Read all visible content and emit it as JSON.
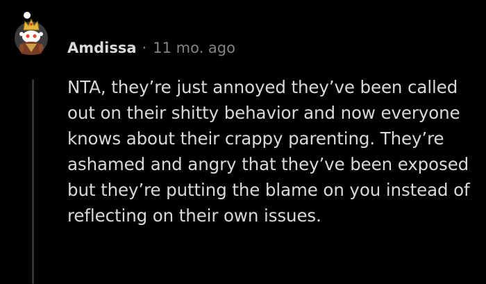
{
  "comment": {
    "author": "Amdissa",
    "separator": "·",
    "age": "11 mo. ago",
    "body": "NTA, they’re just annoyed they’ve been called out on their shitty behavior and now everyone knows about their crappy parenting. They’re ashamed and angry that they’ve been exposed but they’re putting the blame on you instead of reflecting on their own issues.",
    "avatar_icon": "snoo-avatar-icon"
  },
  "colors": {
    "background": "#000000",
    "text": "#d7dadc",
    "meta": "#818384",
    "thread_line": "#343536",
    "avatar_bg": "#3a3a3c"
  }
}
